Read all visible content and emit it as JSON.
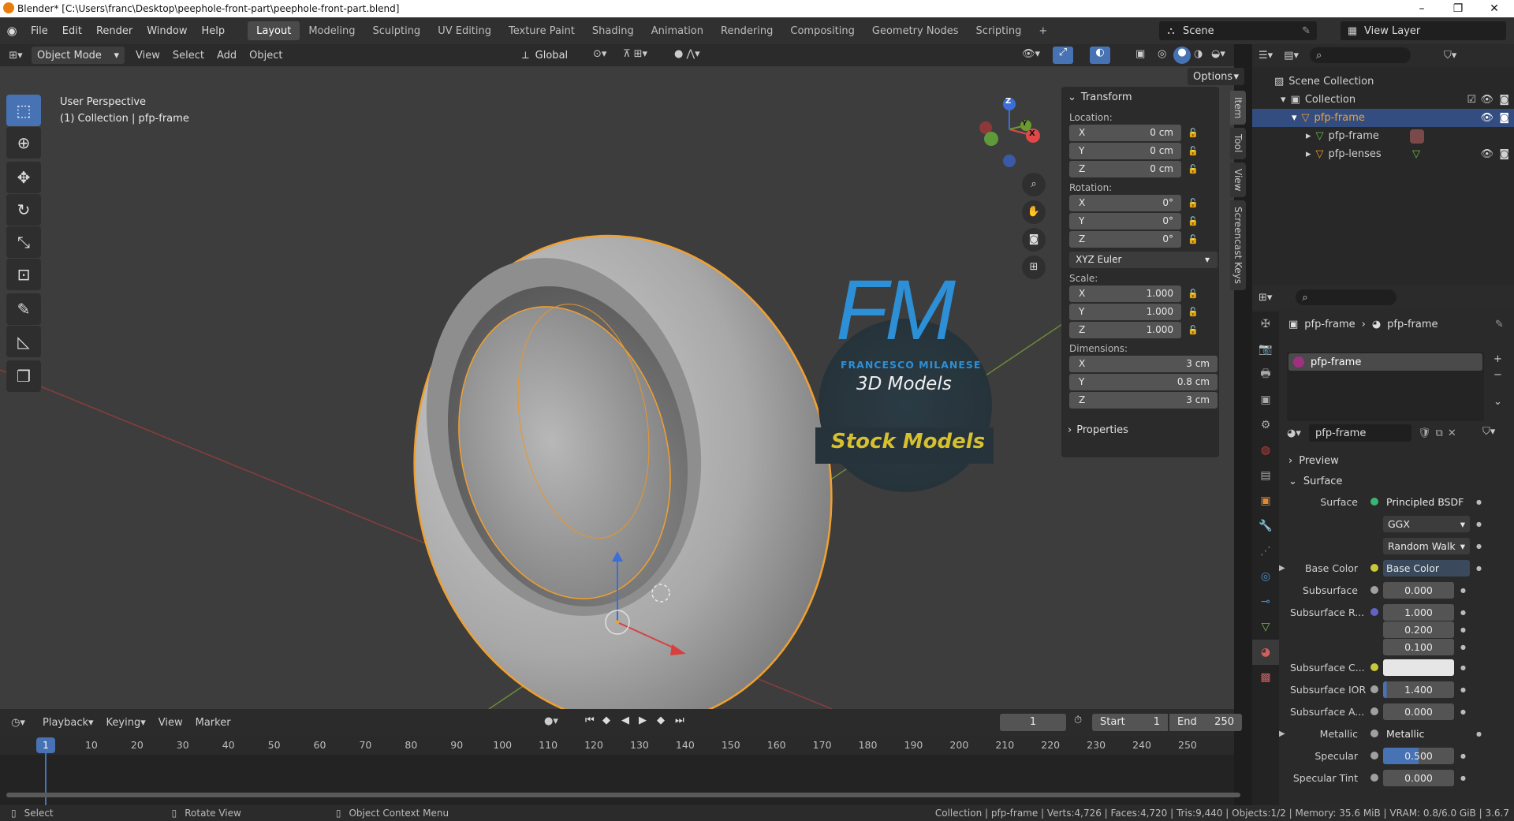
{
  "title_bar": {
    "text": "Blender* [C:\\Users\\franc\\Desktop\\peephole-front-part\\peephole-front-part.blend]",
    "minimize": "–",
    "maximize": "❐",
    "close": "✕"
  },
  "menu": {
    "items": [
      "File",
      "Edit",
      "Render",
      "Window",
      "Help"
    ],
    "workspaces": [
      "Layout",
      "Modeling",
      "Sculpting",
      "UV Editing",
      "Texture Paint",
      "Shading",
      "Animation",
      "Rendering",
      "Compositing",
      "Geometry Nodes",
      "Scripting"
    ],
    "add_tab": "+",
    "scene": "Scene",
    "view_layer": "View Layer"
  },
  "viewport_header": {
    "mode": "Object Mode",
    "menus": [
      "View",
      "Select",
      "Add",
      "Object"
    ],
    "transform_orientation": "Global",
    "options": "Options"
  },
  "viewport": {
    "perspective_label": "User Perspective",
    "collection_label": "(1) Collection | pfp-frame",
    "gizmo": {
      "x": "X",
      "y": "Y",
      "z": "Z"
    },
    "logo": {
      "monogram": "FM",
      "name": "FRANCESCO MILANESE",
      "subtitle": "3D Models",
      "banner": "Stock Models"
    }
  },
  "n_panel": {
    "transform_title": "Transform",
    "location_label": "Location:",
    "location": [
      [
        "X",
        "0 cm"
      ],
      [
        "Y",
        "0 cm"
      ],
      [
        "Z",
        "0 cm"
      ]
    ],
    "rotation_label": "Rotation:",
    "rotation": [
      [
        "X",
        "0°"
      ],
      [
        "Y",
        "0°"
      ],
      [
        "Z",
        "0°"
      ]
    ],
    "rotation_mode": "XYZ Euler",
    "scale_label": "Scale:",
    "scale": [
      [
        "X",
        "1.000"
      ],
      [
        "Y",
        "1.000"
      ],
      [
        "Z",
        "1.000"
      ]
    ],
    "dimensions_label": "Dimensions:",
    "dimensions": [
      [
        "X",
        "3 cm"
      ],
      [
        "Y",
        "0.8 cm"
      ],
      [
        "Z",
        "3 cm"
      ]
    ],
    "properties_title": "Properties",
    "tabs": [
      "Item",
      "Tool",
      "View",
      "Screencast Keys"
    ]
  },
  "outliner": {
    "scene_collection": "Scene Collection",
    "collection": "Collection",
    "items": [
      {
        "name": "pfp-frame",
        "depth": 2,
        "selected": true
      },
      {
        "name": "pfp-frame",
        "depth": 3,
        "selected": false
      },
      {
        "name": "pfp-lenses",
        "depth": 3,
        "selected": false
      }
    ]
  },
  "properties": {
    "breadcrumb_object": "pfp-frame",
    "breadcrumb_material": "pfp-frame",
    "material_slot": "pfp-frame",
    "material_name": "pfp-frame",
    "preview": "Preview",
    "surface_section": "Surface",
    "rows": [
      {
        "label": "Surface",
        "value": "Principled BSDF",
        "dot": "#3cb371"
      },
      {
        "label": "",
        "value": "GGX",
        "dropdown": true
      },
      {
        "label": "",
        "value": "Random Walk",
        "dropdown": true
      },
      {
        "label": "Base Color",
        "value": "Base Color",
        "dot": "#c8c83c",
        "expand": true
      },
      {
        "label": "Subsurface",
        "value": "0.000",
        "dot": "#a0a0a0"
      },
      {
        "label": "Subsurface R...",
        "value": "1.000",
        "dot": "#6363c7"
      },
      {
        "label": "",
        "value": "0.200"
      },
      {
        "label": "",
        "value": "0.100"
      },
      {
        "label": "Subsurface C...",
        "value": "",
        "dot": "#c8c83c",
        "swatch": "#e6e6e6"
      },
      {
        "label": "Subsurface IOR",
        "value": "1.400",
        "dot": "#a0a0a0",
        "bar": 0.05
      },
      {
        "label": "Subsurface A...",
        "value": "0.000",
        "dot": "#a0a0a0"
      },
      {
        "label": "Metallic",
        "value": "Metallic",
        "dot": "#a0a0a0",
        "expand": true
      },
      {
        "label": "Specular",
        "value": "0.500",
        "dot": "#a0a0a0",
        "bar": 0.5
      },
      {
        "label": "Specular Tint",
        "value": "0.000",
        "dot": "#a0a0a0"
      }
    ]
  },
  "timeline": {
    "menus": [
      "Playback",
      "Keying",
      "View",
      "Marker"
    ],
    "current_frame": "1",
    "start_label": "Start",
    "start": "1",
    "end_label": "End",
    "end": "250",
    "ruler": [
      "10",
      "20",
      "30",
      "40",
      "50",
      "60",
      "70",
      "80",
      "90",
      "100",
      "110",
      "120",
      "130",
      "140",
      "150",
      "160",
      "170",
      "180",
      "190",
      "200",
      "210",
      "220",
      "230",
      "240",
      "250"
    ],
    "playhead": "1"
  },
  "status_bar": {
    "select": "Select",
    "rotate": "Rotate View",
    "context": "Object Context Menu",
    "stats": "Collection | pfp-frame | Verts:4,726 | Faces:4,720 | Tris:9,440 | Objects:1/2 | Memory: 35.6 MiB | VRAM: 0.8/6.0 GiB | 3.6.7"
  }
}
